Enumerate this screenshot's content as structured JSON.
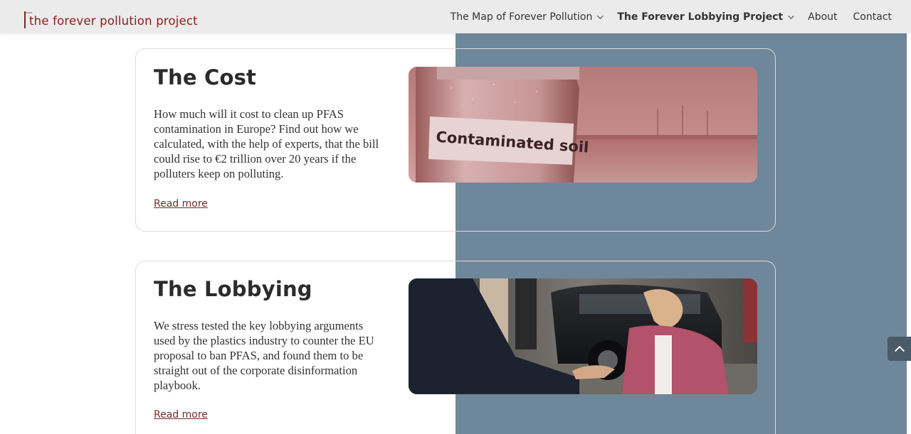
{
  "header": {
    "logo_text": "the forever pollution project",
    "nav": [
      {
        "label": "The Map of Forever Pollution",
        "has_dropdown": true,
        "bold": false
      },
      {
        "label": "The Forever Lobbying Project",
        "has_dropdown": true,
        "bold": true
      },
      {
        "label": "About",
        "has_dropdown": false,
        "bold": false
      },
      {
        "label": "Contact",
        "has_dropdown": false,
        "bold": false
      }
    ]
  },
  "cards": [
    {
      "title": "The Cost",
      "body": "How much will it cost to clean up PFAS contamination in Europe? Find out how we calculated, with the help of experts, that the bill could rise to €2 trillion over 20 years if the polluters keep on polluting.",
      "link": "Read more",
      "image_label": "Contaminated soil"
    },
    {
      "title": "The Lobbying",
      "body": "We stress tested the key lobbying arguments used by the plastics industry to counter the EU proposal to ban PFAS, and found them to be straight out of the corporate disinformation playbook.",
      "link": "Read more"
    }
  ],
  "colors": {
    "accent": "#7a2b2b",
    "logo": "#8c1c1c",
    "right_panel": "#6f879b",
    "header_bg": "#ebebeb",
    "back_to_top": "#4a5a66"
  },
  "icons": [
    "chevron-down-icon",
    "arrow-up-icon"
  ]
}
